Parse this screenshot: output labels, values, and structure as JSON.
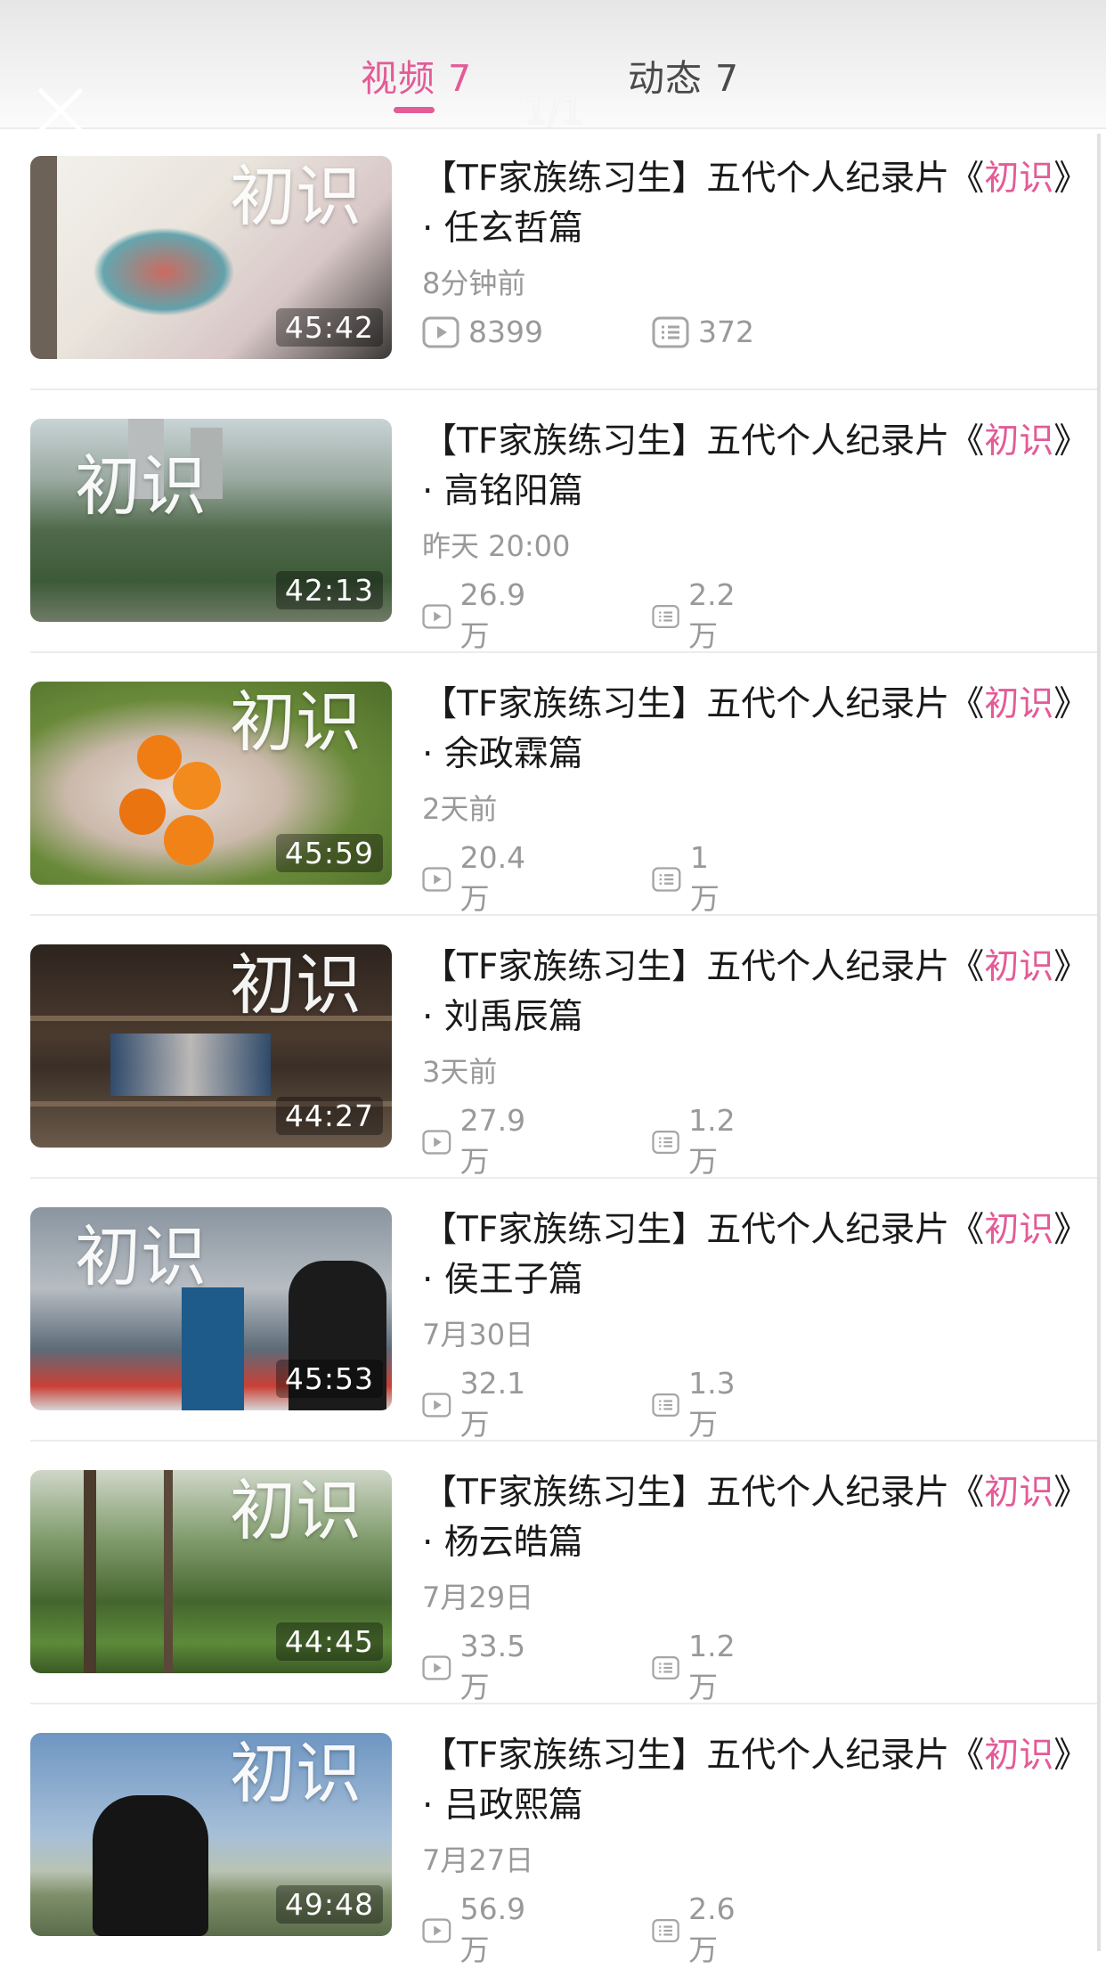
{
  "header": {
    "tabs": [
      {
        "label": "视频 7"
      },
      {
        "label": "动态 7"
      }
    ],
    "pager": "1/1"
  },
  "colors": {
    "accent": "#e35b97",
    "meta": "#999999"
  },
  "videos": [
    {
      "title_prefix": "【TF家族练习生】五代个人纪录片《",
      "title_highlight": "初识",
      "title_suffix": "》· 任玄哲篇",
      "time": "8分钟前",
      "plays": "8399",
      "comments": "372",
      "duration": "45:42",
      "overlay": "初识"
    },
    {
      "title_prefix": "【TF家族练习生】五代个人纪录片《",
      "title_highlight": "初识",
      "title_suffix": "》· 高铭阳篇",
      "time": "昨天 20:00",
      "plays": "26.9万",
      "comments": "2.2万",
      "duration": "42:13",
      "overlay": "初识"
    },
    {
      "title_prefix": "【TF家族练习生】五代个人纪录片《",
      "title_highlight": "初识",
      "title_suffix": "》· 余政霖篇",
      "time": "2天前",
      "plays": "20.4万",
      "comments": "1万",
      "duration": "45:59",
      "overlay": "初识"
    },
    {
      "title_prefix": "【TF家族练习生】五代个人纪录片《",
      "title_highlight": "初识",
      "title_suffix": "》· 刘禹辰篇",
      "time": "3天前",
      "plays": "27.9万",
      "comments": "1.2万",
      "duration": "44:27",
      "overlay": "初识"
    },
    {
      "title_prefix": "【TF家族练习生】五代个人纪录片《",
      "title_highlight": "初识",
      "title_suffix": "》· 侯王子篇",
      "time": "7月30日",
      "plays": "32.1万",
      "comments": "1.3万",
      "duration": "45:53",
      "overlay": "初识"
    },
    {
      "title_prefix": "【TF家族练习生】五代个人纪录片《",
      "title_highlight": "初识",
      "title_suffix": "》· 杨云皓篇",
      "time": "7月29日",
      "plays": "33.5万",
      "comments": "1.2万",
      "duration": "44:45",
      "overlay": "初识"
    },
    {
      "title_prefix": "【TF家族练习生】五代个人纪录片《",
      "title_highlight": "初识",
      "title_suffix": "》· 吕政熙篇",
      "time": "7月27日",
      "plays": "56.9万",
      "comments": "2.6万",
      "duration": "49:48",
      "overlay": "初识"
    }
  ]
}
